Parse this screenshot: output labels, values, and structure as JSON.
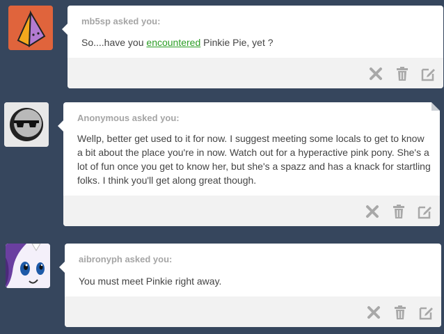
{
  "posts": [
    {
      "asker": "mb5sp asked you:",
      "question_pre": "So....have you ",
      "question_link": "encountered",
      "question_post": " Pinkie Pie, yet ?"
    },
    {
      "asker": "Anonymous asked you:",
      "question": "Wellp, better get used to it for now. I suggest meeting some locals to get to know a bit about the place you're in now. Watch out for a hyperactive pink pony. She's a lot of fun once you get to know her, but she's a spazz and has a knack for startling folks. I think you'll get along great though."
    },
    {
      "asker": "aibronyph asked you:",
      "question": "You must meet Pinkie right away."
    }
  ],
  "icons": {
    "delete": "close-x-icon",
    "trash": "trash-icon",
    "edit": "edit-icon"
  },
  "colors": {
    "background": "#36465d",
    "link": "#2a9d24",
    "asker": "#a5a5a5",
    "icon": "#a8a8a8"
  }
}
